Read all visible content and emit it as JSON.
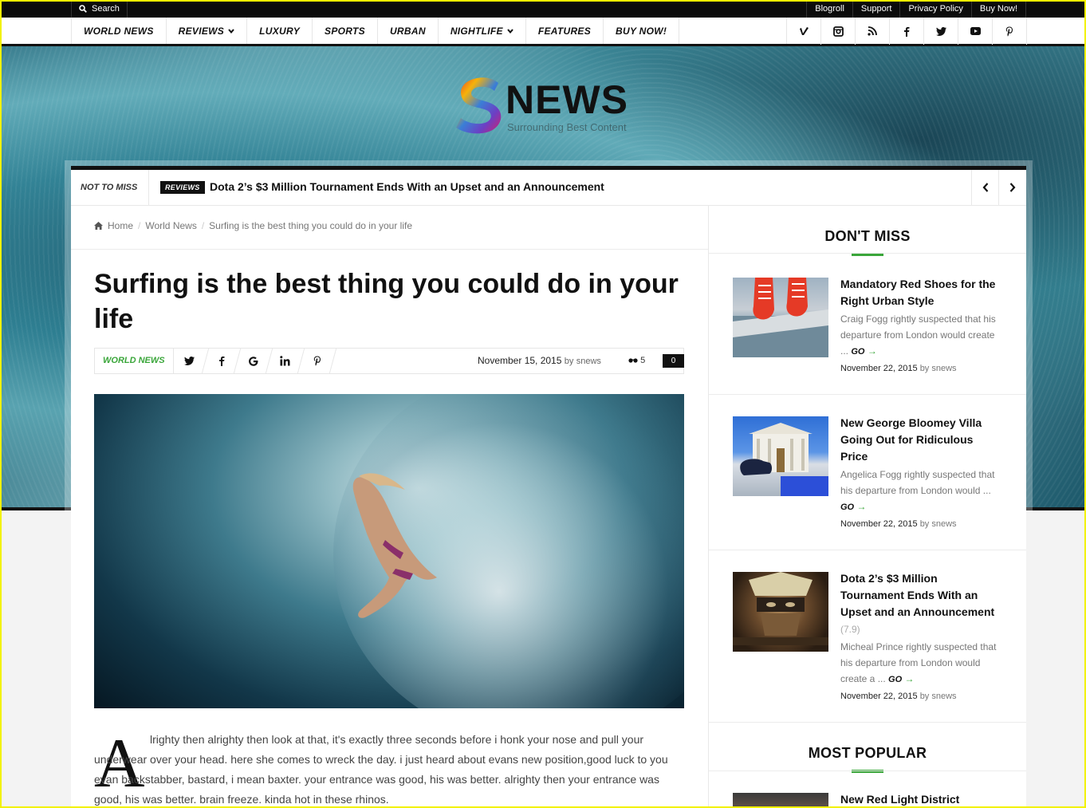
{
  "topbar": {
    "search_label": "Search",
    "links": [
      "Blogroll",
      "Support",
      "Privacy Policy",
      "Buy Now!"
    ]
  },
  "nav": {
    "items": [
      {
        "label": "WORLD NEWS",
        "dropdown": false
      },
      {
        "label": "REVIEWS",
        "dropdown": true
      },
      {
        "label": "LUXURY",
        "dropdown": false
      },
      {
        "label": "SPORTS",
        "dropdown": false
      },
      {
        "label": "URBAN",
        "dropdown": false
      },
      {
        "label": "NIGHTLIFE",
        "dropdown": true
      },
      {
        "label": "FEATURES",
        "dropdown": false
      },
      {
        "label": "BUY NOW!",
        "dropdown": false
      }
    ],
    "social_icons": [
      "vimeo-icon",
      "instagram-icon",
      "rss-icon",
      "facebook-icon",
      "twitter-icon",
      "youtube-icon",
      "pinterest-icon"
    ]
  },
  "logo": {
    "letter": "S",
    "word": "NEWS",
    "tagline": "Surrounding Best Content"
  },
  "ticker": {
    "label": "NOT TO MISS",
    "badge": "REVIEWS",
    "headline": "Dota 2’s $3 Million Tournament Ends With an Upset and an Announcement"
  },
  "breadcrumb": {
    "home": "Home",
    "category": "World News",
    "current": "Surfing is the best thing you could do in your life"
  },
  "article": {
    "title": "Surfing is the best thing you could do in your life",
    "category": "WORLD NEWS",
    "date": "November 15, 2015",
    "by": "by",
    "author": "snews",
    "views": "5",
    "comments": "0",
    "share_icons": [
      "twitter-icon",
      "facebook-icon",
      "google-icon",
      "linkedin-icon",
      "pinterest-icon"
    ],
    "dropcap": "A",
    "body": "lrighty then alrighty then look at that, it's exactly three seconds before i honk your nose and pull your underwear over your head. here she comes to wreck the day. i just heard about evans new position,good luck to you evan backstabber, bastard, i mean baxter. your entrance was good, his was better. alrighty then your entrance was good, his was better. brain freeze. kinda hot in these rhinos."
  },
  "sidebar": {
    "dont_miss_title": "DON'T MISS",
    "most_popular_title": "MOST POPULAR",
    "posts": [
      {
        "title": "Mandatory Red Shoes for the Right Urban Style",
        "score": "",
        "excerpt": "Craig Fogg rightly suspected that his departure from London would create ...",
        "go": "GO",
        "date": "November 22, 2015",
        "by": "by",
        "author": "snews"
      },
      {
        "title": "New George Bloomey Villa Going Out for Ridiculous Price",
        "score": "",
        "excerpt": "Angelica Fogg rightly suspected that his departure from London would ...",
        "go": "GO",
        "date": "November 22, 2015",
        "by": "by",
        "author": "snews"
      },
      {
        "title": "Dota 2’s $3 Million Tournament Ends With an Upset and an Announcement",
        "score": "(7.9)",
        "excerpt": "Micheal Prince rightly suspected that his departure from London would create a ...",
        "go": "GO",
        "date": "November 22, 2015",
        "by": "by",
        "author": "snews"
      }
    ],
    "popular_first_title": "New Red Light District"
  },
  "colors": {
    "accent": "#3aa63a",
    "dark": "#111111",
    "frame": "#f2f200"
  }
}
